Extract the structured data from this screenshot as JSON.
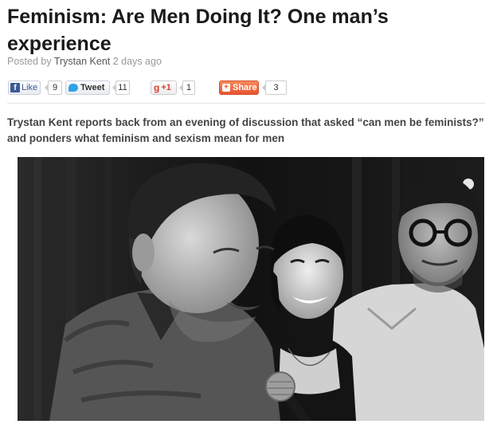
{
  "article": {
    "title": "Feminism: Are Men Doing It? One man’s experience",
    "byline_prefix": "Posted by",
    "author": "Trystan Kent",
    "posted_ago": "2 days ago",
    "lead": "Trystan Kent reports back from an evening  of discussion that asked “can men be feminists?” and ponders what feminism and sexism mean for men"
  },
  "share": {
    "facebook": {
      "label": "Like",
      "icon": "f",
      "count": "9"
    },
    "twitter": {
      "label": "Tweet",
      "count": "11"
    },
    "googleplus": {
      "icon": "g",
      "label": "+1",
      "count": "1"
    },
    "share": {
      "icon": "+",
      "label": "Share",
      "count": "3"
    }
  },
  "photo": {
    "tone": "black-and-white",
    "subjects": [
      "man speaking into microphone",
      "smiling woman",
      "man with glasses"
    ]
  }
}
